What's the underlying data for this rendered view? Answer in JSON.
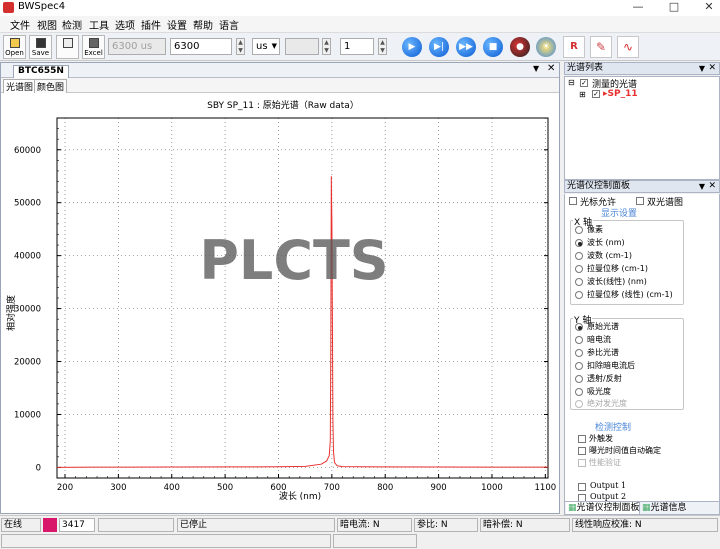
{
  "window": {
    "title": "BWSpec4"
  },
  "menu": [
    "文件",
    "视图",
    "检测",
    "工具",
    "选项",
    "插件",
    "设置",
    "帮助",
    "语言"
  ],
  "toolbar": {
    "open_label": "Open",
    "save_label": "Save",
    "print_label": "",
    "excel_label": "Excel",
    "integration_display": "6300 us",
    "integration_value": "6300",
    "unit": "us",
    "average_value": "1",
    "r_label": "R"
  },
  "doc": {
    "tab": "BTC655N",
    "subtabs": [
      "光谱图",
      "颜色图"
    ]
  },
  "watermark": "PLCTS",
  "chart_data": {
    "type": "line",
    "title": "SBY  SP_11 : 原始光谱（Raw data）",
    "xlabel": "波长 (nm)",
    "ylabel": "相对强度",
    "xlim": [
      185,
      1105
    ],
    "ylim": [
      -2000,
      66000
    ],
    "xticks": [
      200,
      300,
      400,
      500,
      600,
      700,
      800,
      900,
      1000,
      1100
    ],
    "yticks": [
      0,
      10000,
      20000,
      30000,
      40000,
      50000,
      60000
    ],
    "grid": true,
    "series": [
      {
        "color": "#e8312f",
        "x": [
          185,
          250,
          300,
          400,
          500,
          600,
          650,
          680,
          690,
          695,
          697,
          698,
          699,
          700,
          701,
          702,
          703,
          705,
          710,
          720,
          800,
          900,
          1000,
          1105
        ],
        "y": [
          0,
          50,
          60,
          80,
          90,
          120,
          200,
          600,
          1200,
          2200,
          5000,
          22000,
          55000,
          46000,
          28000,
          9000,
          3000,
          900,
          300,
          150,
          90,
          70,
          60,
          50
        ]
      }
    ]
  },
  "speclist": {
    "title": "光谱列表",
    "root_label": "测量的光谱",
    "item_label": "SP_11",
    "item_color": "#e8312f"
  },
  "control": {
    "title": "光谱仪控制面板",
    "cursor_label": "光标允许",
    "dual_label": "双光谱图",
    "display_header": "显示设置",
    "xaxis_title": "X 轴",
    "xaxis_options": [
      "像素",
      "波长 (nm)",
      "波数 (cm-1)",
      "拉曼位移 (cm-1)",
      "波长(线性) (nm)",
      "拉曼位移 (线性) (cm-1)"
    ],
    "xaxis_selected": 1,
    "yaxis_title": "Y 轴",
    "yaxis_options": [
      "原始光谱",
      "暗电流",
      "参比光谱",
      "扣除暗电流后",
      "透射/反射",
      "吸光度",
      "绝对发光度"
    ],
    "yaxis_selected": 0,
    "detect_header": "检测控制",
    "detect_options": [
      "外触发",
      "曝光时间值自动确定",
      "性能验证"
    ],
    "outputs": [
      "Output 1",
      "Output 2"
    ]
  },
  "panel_tabs": [
    "光谱仪控制面板",
    "光谱信息"
  ],
  "status": {
    "online": "在线",
    "indicator_color": "#d8176b",
    "count": "3417",
    "state": "已停止",
    "dark": "暗电流: N",
    "ref": "参比: N",
    "dark_comp": "暗补偿: N",
    "linear": "线性响应校准: N"
  }
}
